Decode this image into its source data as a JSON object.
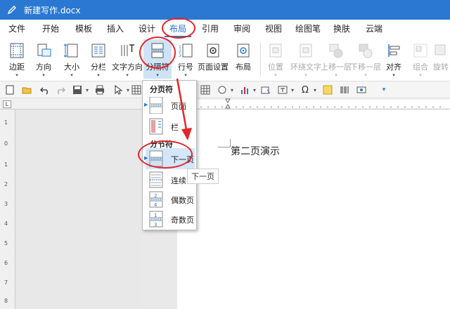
{
  "window": {
    "title": "新建写作.docx"
  },
  "menu": {
    "tabs": [
      "文件",
      "开始",
      "模板",
      "插入",
      "设计",
      "布局",
      "引用",
      "审阅",
      "视图",
      "绘图笔",
      "换肤",
      "云端"
    ],
    "active": "布局"
  },
  "ribbon": {
    "buttons": [
      {
        "label": "边距",
        "icon": "margins-icon",
        "disabled": false
      },
      {
        "label": "方向",
        "icon": "orientation-icon",
        "disabled": false
      },
      {
        "label": "大小",
        "icon": "size-icon",
        "disabled": false
      },
      {
        "label": "分栏",
        "icon": "columns-icon",
        "disabled": false
      },
      {
        "label": "文字方向",
        "icon": "text-direction-icon",
        "disabled": false
      },
      {
        "label": "分隔符",
        "icon": "breaks-icon",
        "disabled": false
      },
      {
        "label": "行号",
        "icon": "line-numbers-icon",
        "disabled": false
      },
      {
        "label": "页面设置",
        "icon": "page-setup-icon",
        "disabled": false
      },
      {
        "label": "布局",
        "icon": "layout-icon",
        "disabled": false
      },
      {
        "label": "位置",
        "icon": "position-icon",
        "disabled": true
      },
      {
        "label": "环绕文字",
        "icon": "wrap-text-icon",
        "disabled": true
      },
      {
        "label": "上移一层",
        "icon": "bring-forward-icon",
        "disabled": true
      },
      {
        "label": "下移一层",
        "icon": "send-backward-icon",
        "disabled": true
      },
      {
        "label": "对齐",
        "icon": "align-icon",
        "disabled": false
      },
      {
        "label": "组合",
        "icon": "group-icon",
        "disabled": true
      },
      {
        "label": "旋转",
        "icon": "rotate-icon",
        "disabled": true
      }
    ]
  },
  "dropdown": {
    "section_page": "分页符",
    "section_section": "分节符",
    "items": {
      "page": "页面",
      "column": "栏",
      "next_page": "下一页",
      "continuous": "连续",
      "even_page": "偶数页",
      "odd_page": "奇数页"
    },
    "tooltip": "下一页"
  },
  "ruler": {
    "corner": "L",
    "vertical_numbers": [
      "1",
      "0",
      "1",
      "2",
      "3",
      "4",
      "5",
      "6",
      "7",
      "8"
    ]
  },
  "document": {
    "text": "第二页演示"
  },
  "colors": {
    "titlebar": "#2b78d3",
    "annotation": "#e3262b",
    "hover": "#d4e6fa"
  }
}
